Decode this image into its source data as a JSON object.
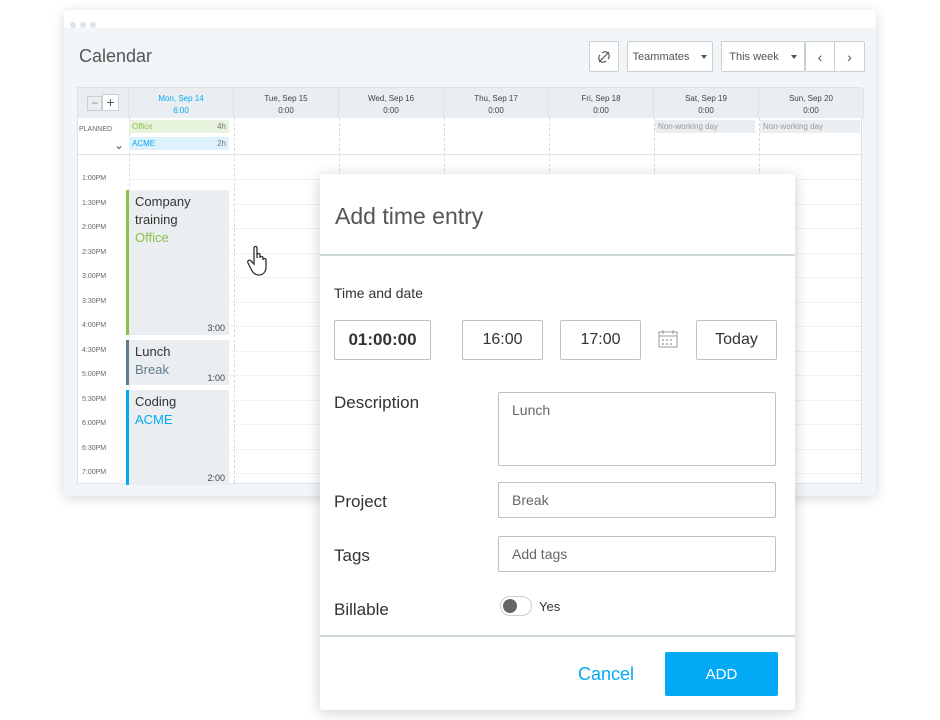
{
  "calendar": {
    "title": "Calendar",
    "filters": {
      "teammates": "Teammates",
      "range": "This week"
    },
    "planned_label": "PLANNED",
    "days": [
      {
        "date": "Mon, Sep 14",
        "total": "6:00",
        "today": true
      },
      {
        "date": "Tue, Sep 15",
        "total": "0:00"
      },
      {
        "date": "Wed, Sep 16",
        "total": "0:00"
      },
      {
        "date": "Thu, Sep 17",
        "total": "0:00"
      },
      {
        "date": "Fri, Sep 18",
        "total": "0:00"
      },
      {
        "date": "Sat, Sep 19",
        "total": "0:00"
      },
      {
        "date": "Sun, Sep 20",
        "total": "0:00"
      }
    ],
    "planned": [
      {
        "name": "Office",
        "hours": "4h",
        "color": "#8bc34a"
      },
      {
        "name": "ACME",
        "hours": "2h",
        "color": "#03a9f4"
      }
    ],
    "non_working": "Non-working day",
    "times": [
      "1:00PM",
      "1:30PM",
      "2:00PM",
      "2:30PM",
      "3:00PM",
      "3:30PM",
      "4:00PM",
      "4:30PM",
      "5:00PM",
      "5:30PM",
      "6:00PM",
      "6:30PM",
      "7:00PM"
    ],
    "entries": [
      {
        "title": "Company training",
        "project": "Office",
        "duration": "3:00",
        "color": "#8bc34a"
      },
      {
        "title": "Lunch",
        "project": "Break",
        "duration": "1:00",
        "color": "#607d8b"
      },
      {
        "title": "Coding",
        "project": "ACME",
        "duration": "2:00",
        "color": "#03a9f4"
      }
    ]
  },
  "modal": {
    "title": "Add time entry",
    "time_and_date_label": "Time and date",
    "duration": "01:00:00",
    "start": "16:00",
    "end": "17:00",
    "date_button": "Today",
    "description_label": "Description",
    "description_value": "Lunch",
    "project_label": "Project",
    "project_value": "Break",
    "tags_label": "Tags",
    "tags_placeholder": "Add tags",
    "billable_label": "Billable",
    "billable_toggle_text": "Yes",
    "cancel": "Cancel",
    "add": "ADD"
  },
  "colors": {
    "accent": "#03a9f4"
  }
}
